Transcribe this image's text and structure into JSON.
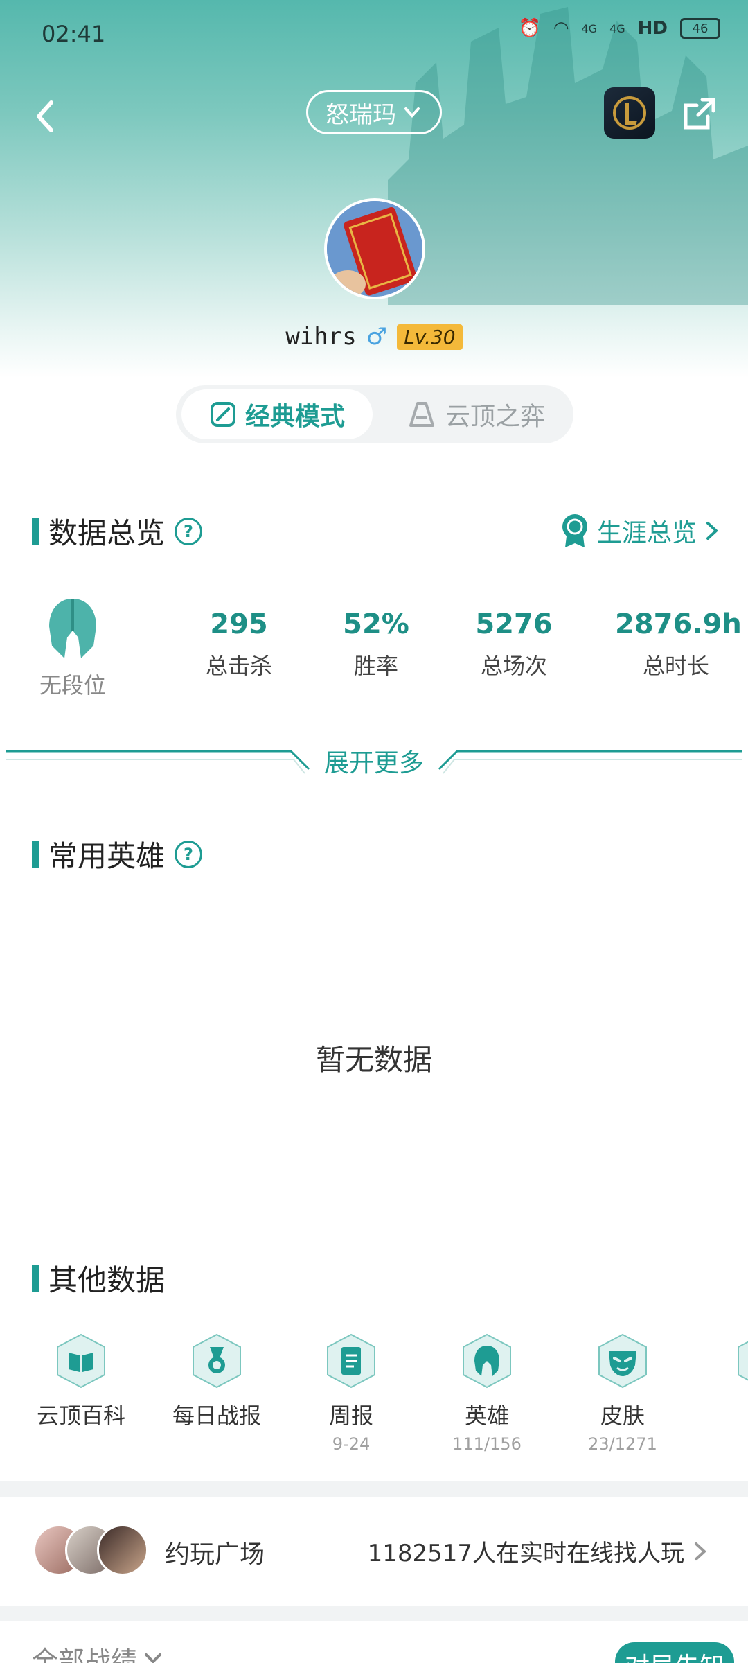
{
  "status": {
    "time": "02:41",
    "network_1": "4G",
    "network_2": "4G",
    "hd": "HD",
    "battery": "46"
  },
  "header": {
    "server": "怒瑞玛"
  },
  "profile": {
    "username": "wihrs",
    "gender_symbol": "♂",
    "level": "Lv.30"
  },
  "mode_tabs": [
    {
      "label": "经典模式"
    },
    {
      "label": "云顶之弈"
    }
  ],
  "overview": {
    "title": "数据总览",
    "help": "?",
    "career_link": "生涯总览",
    "rank_label": "无段位",
    "stats": [
      {
        "value": "295",
        "label": "总击杀"
      },
      {
        "value": "52%",
        "label": "胜率"
      },
      {
        "value": "5276",
        "label": "总场次"
      },
      {
        "value": "2876.9h",
        "label": "总时长"
      }
    ],
    "expand_label": "展开更多"
  },
  "heroes": {
    "title": "常用英雄",
    "help": "?",
    "empty": "暂无数据"
  },
  "other": {
    "title": "其他数据",
    "items": [
      {
        "label": "云顶百科",
        "sub": "",
        "icon": "book-icon"
      },
      {
        "label": "每日战报",
        "sub": "",
        "icon": "medal-icon"
      },
      {
        "label": "周报",
        "sub": "9-24",
        "icon": "document-icon"
      },
      {
        "label": "英雄",
        "sub": "111/156",
        "icon": "helmet-icon"
      },
      {
        "label": "皮肤",
        "sub": "23/1271",
        "icon": "mask-icon"
      }
    ]
  },
  "play_square": {
    "title": "约玩广场",
    "online": "1182517人在实时在线找人玩"
  },
  "bottom": {
    "all_records": "全部战绩",
    "pre_know": "对局先知"
  },
  "colors": {
    "accent": "#1e9c93",
    "level_badge": "#f4b93a"
  }
}
